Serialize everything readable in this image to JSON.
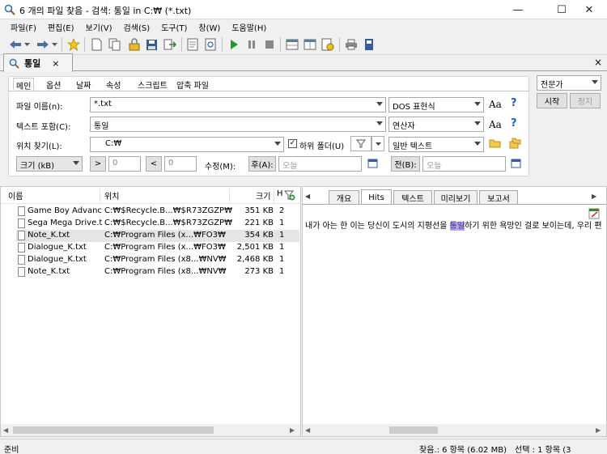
{
  "window": {
    "title": "6 개의 파일 찾음 - 검색: 통일 in C:₩ (*.txt)"
  },
  "menu": [
    "파일(F)",
    "편집(E)",
    "보기(V)",
    "검색(S)",
    "도구(T)",
    "창(W)",
    "도움말(H)"
  ],
  "tab": {
    "label": "통일"
  },
  "subtabs": [
    "메인",
    "옵션",
    "날짜",
    "속성",
    "스크립트",
    "압축 파일"
  ],
  "form": {
    "filename_label": "파일 이름(n):",
    "filename_value": "*.txt",
    "filename_mode": "DOS 표현식",
    "text_label": "텍스트 포함(C):",
    "text_value": "통일",
    "text_mode": "연산자",
    "location_label": "위치 찾기(L):",
    "location_value": "C:₩",
    "subfolders_label": "하위 폴더(U)",
    "subfolders_checked": true,
    "text_type": "일반 텍스트",
    "size_mode": "크기 (kB)",
    "size_gt": ">",
    "size_gt_value": "0",
    "size_lt": "<",
    "size_lt_value": "0",
    "modified_label": "수정(M):",
    "after_label": "후(A):",
    "after_placeholder": "오늘",
    "before_label": "전(B):",
    "before_placeholder": "오늘"
  },
  "right_controls": {
    "mode": "전문가",
    "start": "시작",
    "stop": "정지"
  },
  "list": {
    "columns": [
      "이름",
      "위치",
      "크기",
      "H"
    ],
    "rows": [
      {
        "name": "Game Boy Advanc...",
        "location": "C:₩$Recycle.B...₩$R73ZGZP₩",
        "size": "351 KB",
        "h": "2"
      },
      {
        "name": "Sega Mega Drive.txt",
        "location": "C:₩$Recycle.B...₩$R73ZGZP₩",
        "size": "221 KB",
        "h": "1"
      },
      {
        "name": "Note_K.txt",
        "location": "C:₩Program Files (x...₩FO3₩",
        "size": "354 KB",
        "h": "1"
      },
      {
        "name": "Dialogue_K.txt",
        "location": "C:₩Program Files (x...₩FO3₩",
        "size": "2,501 KB",
        "h": "1"
      },
      {
        "name": "Dialogue_K.txt",
        "location": "C:₩Program Files (x8...₩NV₩",
        "size": "2,468 KB",
        "h": "1"
      },
      {
        "name": "Note_K.txt",
        "location": "C:₩Program Files (x8...₩NV₩",
        "size": "273 KB",
        "h": "1"
      }
    ]
  },
  "preview": {
    "tabs": [
      "개요",
      "Hits",
      "텍스트",
      "미리보기",
      "보고서"
    ],
    "active_tab": "Hits",
    "text_before": "내가 아는 한 이는 당신이 도시의 지평선을 ",
    "text_hit": "통일",
    "text_after": "하기 위한 욕망인 걸로 보이는데, 우리 편"
  },
  "status": {
    "left": "준비",
    "found": "찾음.: 6 항목 (6.02 MB)",
    "selected": "선택 : 1 항목 (3"
  }
}
